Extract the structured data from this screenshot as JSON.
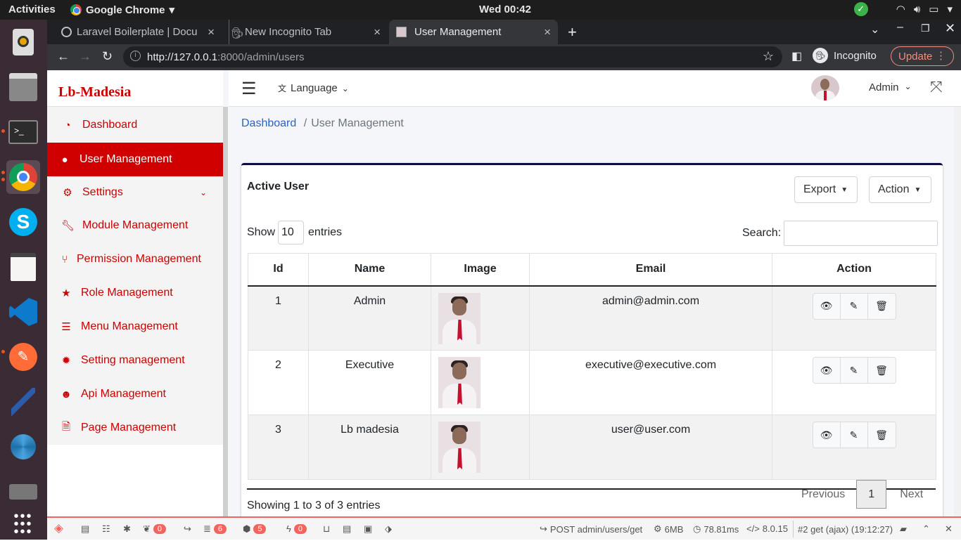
{
  "system": {
    "activities": "Activities",
    "app": "Google Chrome",
    "clock": "Wed 00:42"
  },
  "tabs": [
    {
      "label": "Laravel Boilerplate | Docu"
    },
    {
      "label": "New Incognito Tab"
    },
    {
      "label": "User Management"
    }
  ],
  "url": {
    "host": "http://127.0.0.1",
    "path": ":8000/admin/users"
  },
  "incognito": "Incognito",
  "update": "Update",
  "brand": "Lb-Madesia",
  "menu": [
    {
      "label": "Dashboard",
      "icon": "tachometer-icon"
    },
    {
      "label": "User Management",
      "icon": "user-icon"
    },
    {
      "label": "Settings",
      "icon": "cogs-icon"
    },
    {
      "label": "Module Management",
      "icon": "wrench-icon"
    },
    {
      "label": "Permission Management",
      "icon": "fork-icon"
    },
    {
      "label": "Role Management",
      "icon": "star-icon"
    },
    {
      "label": "Menu Management",
      "icon": "bars-icon"
    },
    {
      "label": "Setting management",
      "icon": "cog-icon"
    },
    {
      "label": "Api Management",
      "icon": "reddit-icon"
    },
    {
      "label": "Page Management",
      "icon": "file-icon"
    }
  ],
  "navbar": {
    "language": "Language",
    "user": "Admin"
  },
  "breadcrumb": {
    "home": "Dashboard",
    "sep": "/",
    "current": "User Management"
  },
  "card": {
    "title": "Active User",
    "export": "Export",
    "action": "Action",
    "show": "Show",
    "entries_value": "10",
    "entries": "entries",
    "search": "Search:",
    "columns": [
      "Id",
      "Name",
      "Image",
      "Email",
      "Action"
    ],
    "rows": [
      {
        "id": "1",
        "name": "Admin",
        "email": "admin@admin.com"
      },
      {
        "id": "2",
        "name": "Executive",
        "email": "executive@executive.com"
      },
      {
        "id": "3",
        "name": "Lb madesia",
        "email": "user@user.com"
      }
    ],
    "info": "Showing 1 to 3 of 3 entries",
    "prev": "Previous",
    "page": "1",
    "next": "Next"
  },
  "debugbar": {
    "queries": "0",
    "db": "6",
    "models": "5",
    "events": "0",
    "route": "POST admin/users/get",
    "mem": "6MB",
    "time": "78.81ms",
    "php": "8.0.15",
    "req": "#2 get (ajax) (19:12:27)"
  }
}
